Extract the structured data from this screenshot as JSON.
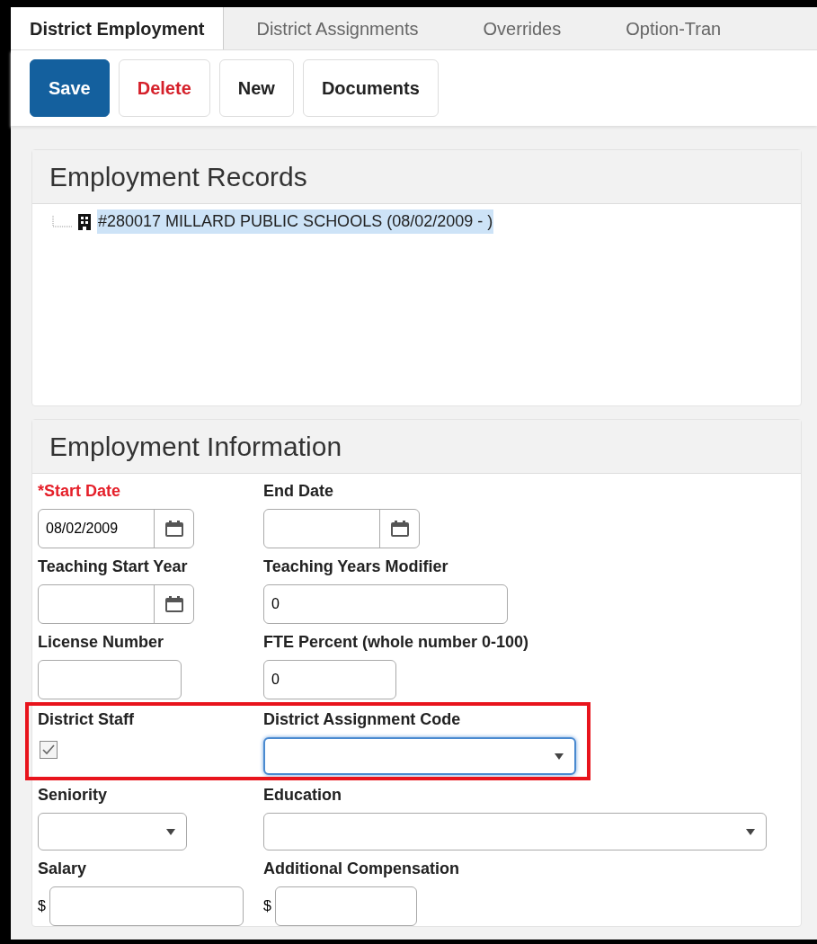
{
  "tabs": [
    {
      "label": "District Employment",
      "selected": true
    },
    {
      "label": "District Assignments",
      "selected": false
    },
    {
      "label": "Overrides",
      "selected": false
    },
    {
      "label": "Option-Tran",
      "selected": false
    }
  ],
  "toolbar": [
    {
      "label": "Save",
      "kind": "primary"
    },
    {
      "label": "Delete",
      "kind": "danger"
    },
    {
      "label": "New",
      "kind": "plain"
    },
    {
      "label": "Documents",
      "kind": "plain"
    }
  ],
  "records_panel": {
    "title": "Employment Records",
    "items": [
      {
        "label": "#280017 MILLARD PUBLIC SCHOOLS (08/02/2009 - )",
        "selected": true
      }
    ]
  },
  "info_panel": {
    "title": "Employment Information",
    "rows": [
      {
        "highlighted": false,
        "fields": [
          {
            "label": "Start Date",
            "required": true,
            "marker": "*",
            "kind": "date",
            "value": "08/02/2009"
          },
          {
            "label": "End Date",
            "required": false,
            "kind": "date"
          }
        ]
      },
      {
        "highlighted": false,
        "fields": [
          {
            "label": "Teaching Start Year",
            "required": false,
            "kind": "date"
          },
          {
            "label": "Teaching Years Modifier",
            "required": false,
            "kind": "text",
            "value": "0"
          }
        ]
      },
      {
        "highlighted": false,
        "fields": [
          {
            "label": "License Number",
            "required": false,
            "kind": "text"
          },
          {
            "label": "FTE Percent (whole number 0-100)",
            "required": false,
            "kind": "text",
            "value": "0"
          }
        ]
      },
      {
        "highlighted": true,
        "fields": [
          {
            "label": "District Staff",
            "required": false,
            "kind": "checkbox",
            "checked": true
          },
          {
            "label": "District Assignment Code",
            "required": false,
            "kind": "select",
            "focused": true
          }
        ]
      },
      {
        "highlighted": false,
        "fields": [
          {
            "label": "Seniority",
            "required": false,
            "kind": "select",
            "focused": false
          },
          {
            "label": "Education",
            "required": false,
            "kind": "select",
            "focused": false
          }
        ]
      },
      {
        "highlighted": false,
        "fields": [
          {
            "label": "Salary",
            "required": false,
            "kind": "currency",
            "symbol": "$"
          },
          {
            "label": "Additional Compensation",
            "required": false,
            "kind": "currency",
            "symbol": "$"
          }
        ]
      }
    ]
  }
}
